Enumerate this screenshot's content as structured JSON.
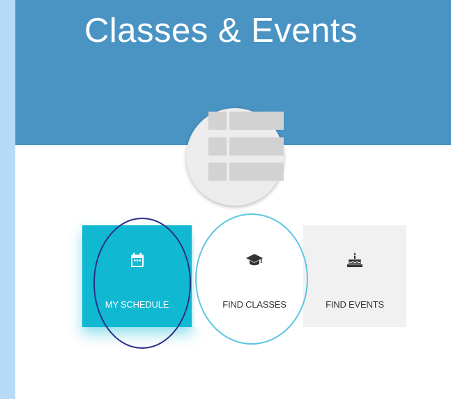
{
  "header": {
    "title": "Classes & Events",
    "background": "#4a94c4"
  },
  "hero": {
    "icon": "table-list-icon"
  },
  "tiles": [
    {
      "label": "MY SCHEDULE",
      "icon": "calendar-icon",
      "color": "#10b8d2",
      "active": true
    },
    {
      "label": "FIND CLASSES",
      "icon": "graduation-cap-icon",
      "color": "#ffffff",
      "active": false
    },
    {
      "label": "FIND EVENTS",
      "icon": "birthday-cake-icon",
      "color": "#f1f1f1",
      "active": false
    }
  ],
  "annotations": {
    "ring_schedule_color": "#2a2f86",
    "ring_classes_color": "#5cc6e6"
  }
}
